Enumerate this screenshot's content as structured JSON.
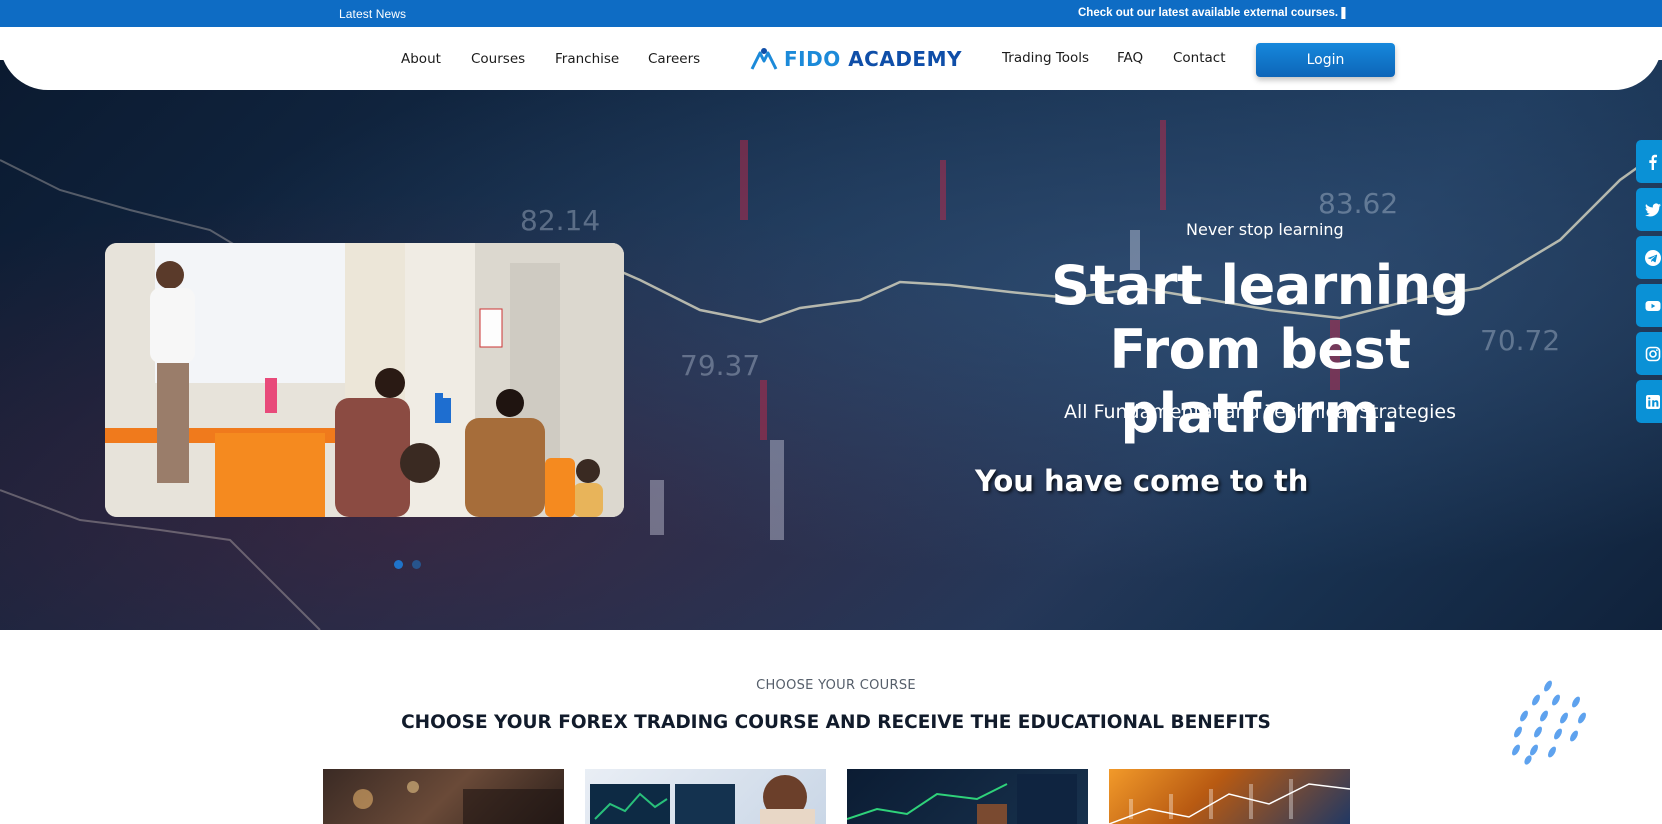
{
  "topbar": {
    "latest_label": "Latest News",
    "ticker_text": "Check out our latest available external courses. ▌ \\"
  },
  "nav": {
    "left_items": [
      "About",
      "Courses",
      "Franchise",
      "Careers"
    ],
    "right_items": [
      "Trading Tools",
      "FAQ",
      "Contact"
    ],
    "logo": {
      "part1": "FIDO",
      "part2": "ACADEMY"
    },
    "login_label": "Login"
  },
  "hero": {
    "tagline": "Never stop learning",
    "title_line1": "Start learning",
    "title_line2": "From best platform.",
    "subtitle": "All Fundamental and Technical Strategies",
    "typed_text": "You have come to th",
    "slider_dots": 2,
    "active_dot": 0,
    "chart_labels": [
      "82.14",
      "79.37",
      "83.62",
      "70.72"
    ]
  },
  "social": [
    "facebook-icon",
    "twitter-icon",
    "telegram-icon",
    "youtube-icon",
    "instagram-icon",
    "linkedin-icon"
  ],
  "courses": {
    "eyebrow": "CHOOSE YOUR COURSE",
    "heading": "CHOOSE YOUR FOREX TRADING COURSE AND RECEIVE THE EDUCATIONAL BENEFITS",
    "cards": [
      "course-card-1",
      "course-card-2",
      "course-card-3",
      "course-card-4"
    ]
  },
  "colors": {
    "topbar": "#0e6cc4",
    "brand_light": "#1c8ad9",
    "brand_dark": "#0f4ea8",
    "social": "#0a91d6",
    "hero_bg": "#16304f"
  }
}
